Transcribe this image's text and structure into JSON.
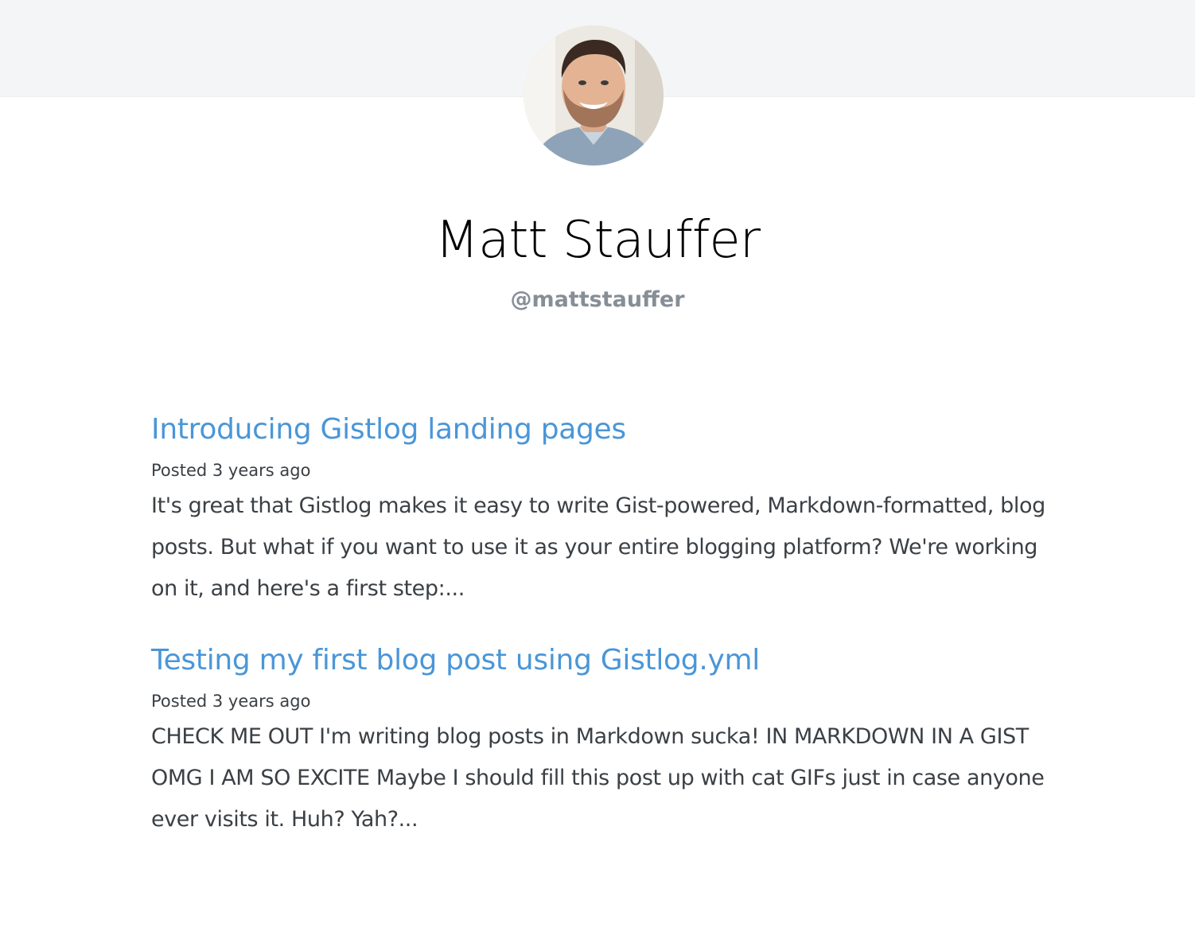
{
  "profile": {
    "name": "Matt Stauffer",
    "handle": "@mattstauffer"
  },
  "posts": [
    {
      "title": "Introducing Gistlog landing pages",
      "posted": "Posted 3 years ago",
      "excerpt": "It's great that Gistlog makes it easy to write Gist-powered, Markdown-formatted, blog posts. But what if you want to use it as your entire blogging platform? We're working on it, and here's a first step:..."
    },
    {
      "title": "Testing my first blog post using Gistlog.yml",
      "posted": "Posted 3 years ago",
      "excerpt": "CHECK ME OUT I'm writing blog posts in Markdown sucka! IN MARKDOWN IN A GIST OMG I AM SO EXCITE Maybe I should fill this post up with cat GIFs just in case anyone ever visits it. Huh? Yah?..."
    }
  ],
  "colors": {
    "header_band": "#f4f5f7",
    "link": "#4a96d8",
    "handle": "#868e96",
    "body_text": "#3b4045"
  }
}
